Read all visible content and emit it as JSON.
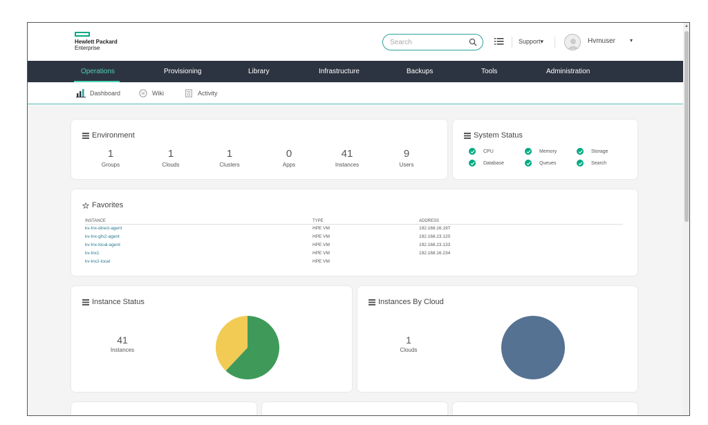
{
  "brand": {
    "line1": "Hewlett Packard",
    "line2": "Enterprise",
    "color": "#01a982"
  },
  "header": {
    "search_placeholder": "Search",
    "support_label": "Support",
    "support_caret": "▾",
    "username": "Hvmuser",
    "user_caret": "▾"
  },
  "nav": {
    "items": [
      {
        "label": "Operations",
        "active": true
      },
      {
        "label": "Provisioning"
      },
      {
        "label": "Library"
      },
      {
        "label": "Infrastructure"
      },
      {
        "label": "Backups"
      },
      {
        "label": "Tools"
      },
      {
        "label": "Administration"
      }
    ]
  },
  "subnav": {
    "items": [
      {
        "label": "Dashboard",
        "icon": "bar-chart-icon"
      },
      {
        "label": "Wiki",
        "icon": "wiki-icon"
      },
      {
        "label": "Activity",
        "icon": "activity-icon"
      }
    ]
  },
  "environment": {
    "title": "Environment",
    "stats": [
      {
        "value": "1",
        "label": "Groups"
      },
      {
        "value": "1",
        "label": "Clouds"
      },
      {
        "value": "1",
        "label": "Clusters"
      },
      {
        "value": "0",
        "label": "Apps"
      },
      {
        "value": "41",
        "label": "Instances"
      },
      {
        "value": "9",
        "label": "Users"
      }
    ]
  },
  "system_status": {
    "title": "System Status",
    "items": [
      {
        "label": "CPU",
        "ok": true
      },
      {
        "label": "Memory",
        "ok": true
      },
      {
        "label": "Storage",
        "ok": true
      },
      {
        "label": "Database",
        "ok": true
      },
      {
        "label": "Queues",
        "ok": true
      },
      {
        "label": "Search",
        "ok": true
      }
    ]
  },
  "favorites": {
    "title": "Favorites",
    "columns": [
      "INSTANCE",
      "TYPE",
      "ADDRESS"
    ],
    "rows": [
      {
        "instance": "kv-lnx-direct-agent",
        "type": "HPE VM",
        "address": "192.168.16.197"
      },
      {
        "instance": "kv-lnx-gfs2-agent",
        "type": "HPE VM",
        "address": "192.168.23.120"
      },
      {
        "instance": "kv-lnx-local-agent",
        "type": "HPE VM",
        "address": "192.168.23.133"
      },
      {
        "instance": "kv-lnx1",
        "type": "HPE VM",
        "address": "192.168.16.234"
      },
      {
        "instance": "kv-lnx2-local",
        "type": "HPE VM",
        "address": ""
      }
    ]
  },
  "instance_status": {
    "title": "Instance Status",
    "value": "41",
    "label": "Instances",
    "slices": [
      {
        "share": 0.62,
        "color": "#3f9a5a"
      },
      {
        "share": 0.38,
        "color": "#f2cb55"
      }
    ]
  },
  "instances_by_cloud": {
    "title": "Instances By Cloud",
    "value": "1",
    "label": "Clouds",
    "slices": [
      {
        "share": 1.0,
        "color": "#557292"
      }
    ]
  },
  "colors": {
    "nav_bg": "#2d3441",
    "accent": "#4fd2b5",
    "ok": "#01a982"
  }
}
